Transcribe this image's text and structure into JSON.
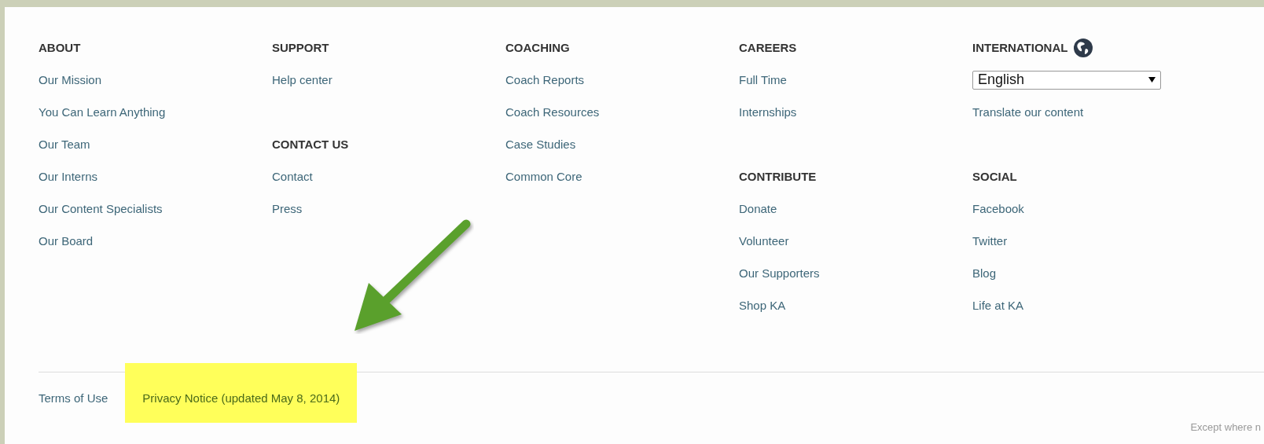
{
  "columns": [
    {
      "sections": [
        {
          "heading": "ABOUT",
          "kind": "plain",
          "items": [
            {
              "kind": "link",
              "text": "Our Mission"
            },
            {
              "kind": "link",
              "text": "You Can Learn Anything"
            },
            {
              "kind": "link",
              "text": "Our Team"
            },
            {
              "kind": "link",
              "text": "Our Interns"
            },
            {
              "kind": "link",
              "text": "Our Content Specialists"
            },
            {
              "kind": "link",
              "text": "Our Board"
            }
          ]
        }
      ]
    },
    {
      "sections": [
        {
          "heading": "SUPPORT",
          "kind": "plain",
          "items": [
            {
              "kind": "link",
              "text": "Help center"
            }
          ]
        },
        {
          "heading": "CONTACT US",
          "kind": "plain",
          "items": [
            {
              "kind": "link",
              "text": "Contact"
            },
            {
              "kind": "link",
              "text": "Press"
            }
          ]
        }
      ]
    },
    {
      "sections": [
        {
          "heading": "COACHING",
          "kind": "plain",
          "items": [
            {
              "kind": "link",
              "text": "Coach Reports"
            },
            {
              "kind": "link",
              "text": "Coach Resources"
            },
            {
              "kind": "link",
              "text": "Case Studies"
            },
            {
              "kind": "link",
              "text": "Common Core"
            }
          ]
        }
      ]
    },
    {
      "sections": [
        {
          "heading": "CAREERS",
          "kind": "plain",
          "items": [
            {
              "kind": "link",
              "text": "Full Time"
            },
            {
              "kind": "link",
              "text": "Internships"
            }
          ]
        },
        {
          "heading": "CONTRIBUTE",
          "kind": "plain",
          "items": [
            {
              "kind": "link",
              "text": "Donate"
            },
            {
              "kind": "link",
              "text": "Volunteer"
            },
            {
              "kind": "link",
              "text": "Our Supporters"
            },
            {
              "kind": "link",
              "text": "Shop KA"
            }
          ]
        }
      ]
    },
    {
      "sections": [
        {
          "heading": "INTERNATIONAL",
          "kind": "globe",
          "items": [
            {
              "kind": "select",
              "text": "English"
            },
            {
              "kind": "link",
              "text": "Translate our content"
            }
          ]
        },
        {
          "heading": "SOCIAL",
          "kind": "plain",
          "items": [
            {
              "kind": "link",
              "text": "Facebook"
            },
            {
              "kind": "link",
              "text": "Twitter"
            },
            {
              "kind": "link",
              "text": "Blog"
            },
            {
              "kind": "link",
              "text": "Life at KA"
            }
          ]
        }
      ]
    }
  ],
  "bottom_links": [
    {
      "text": "Terms of Use",
      "highlighted": false
    },
    {
      "text": "Privacy Notice (updated May 8, 2014)",
      "highlighted": true
    }
  ],
  "license_note": "Except where n"
}
